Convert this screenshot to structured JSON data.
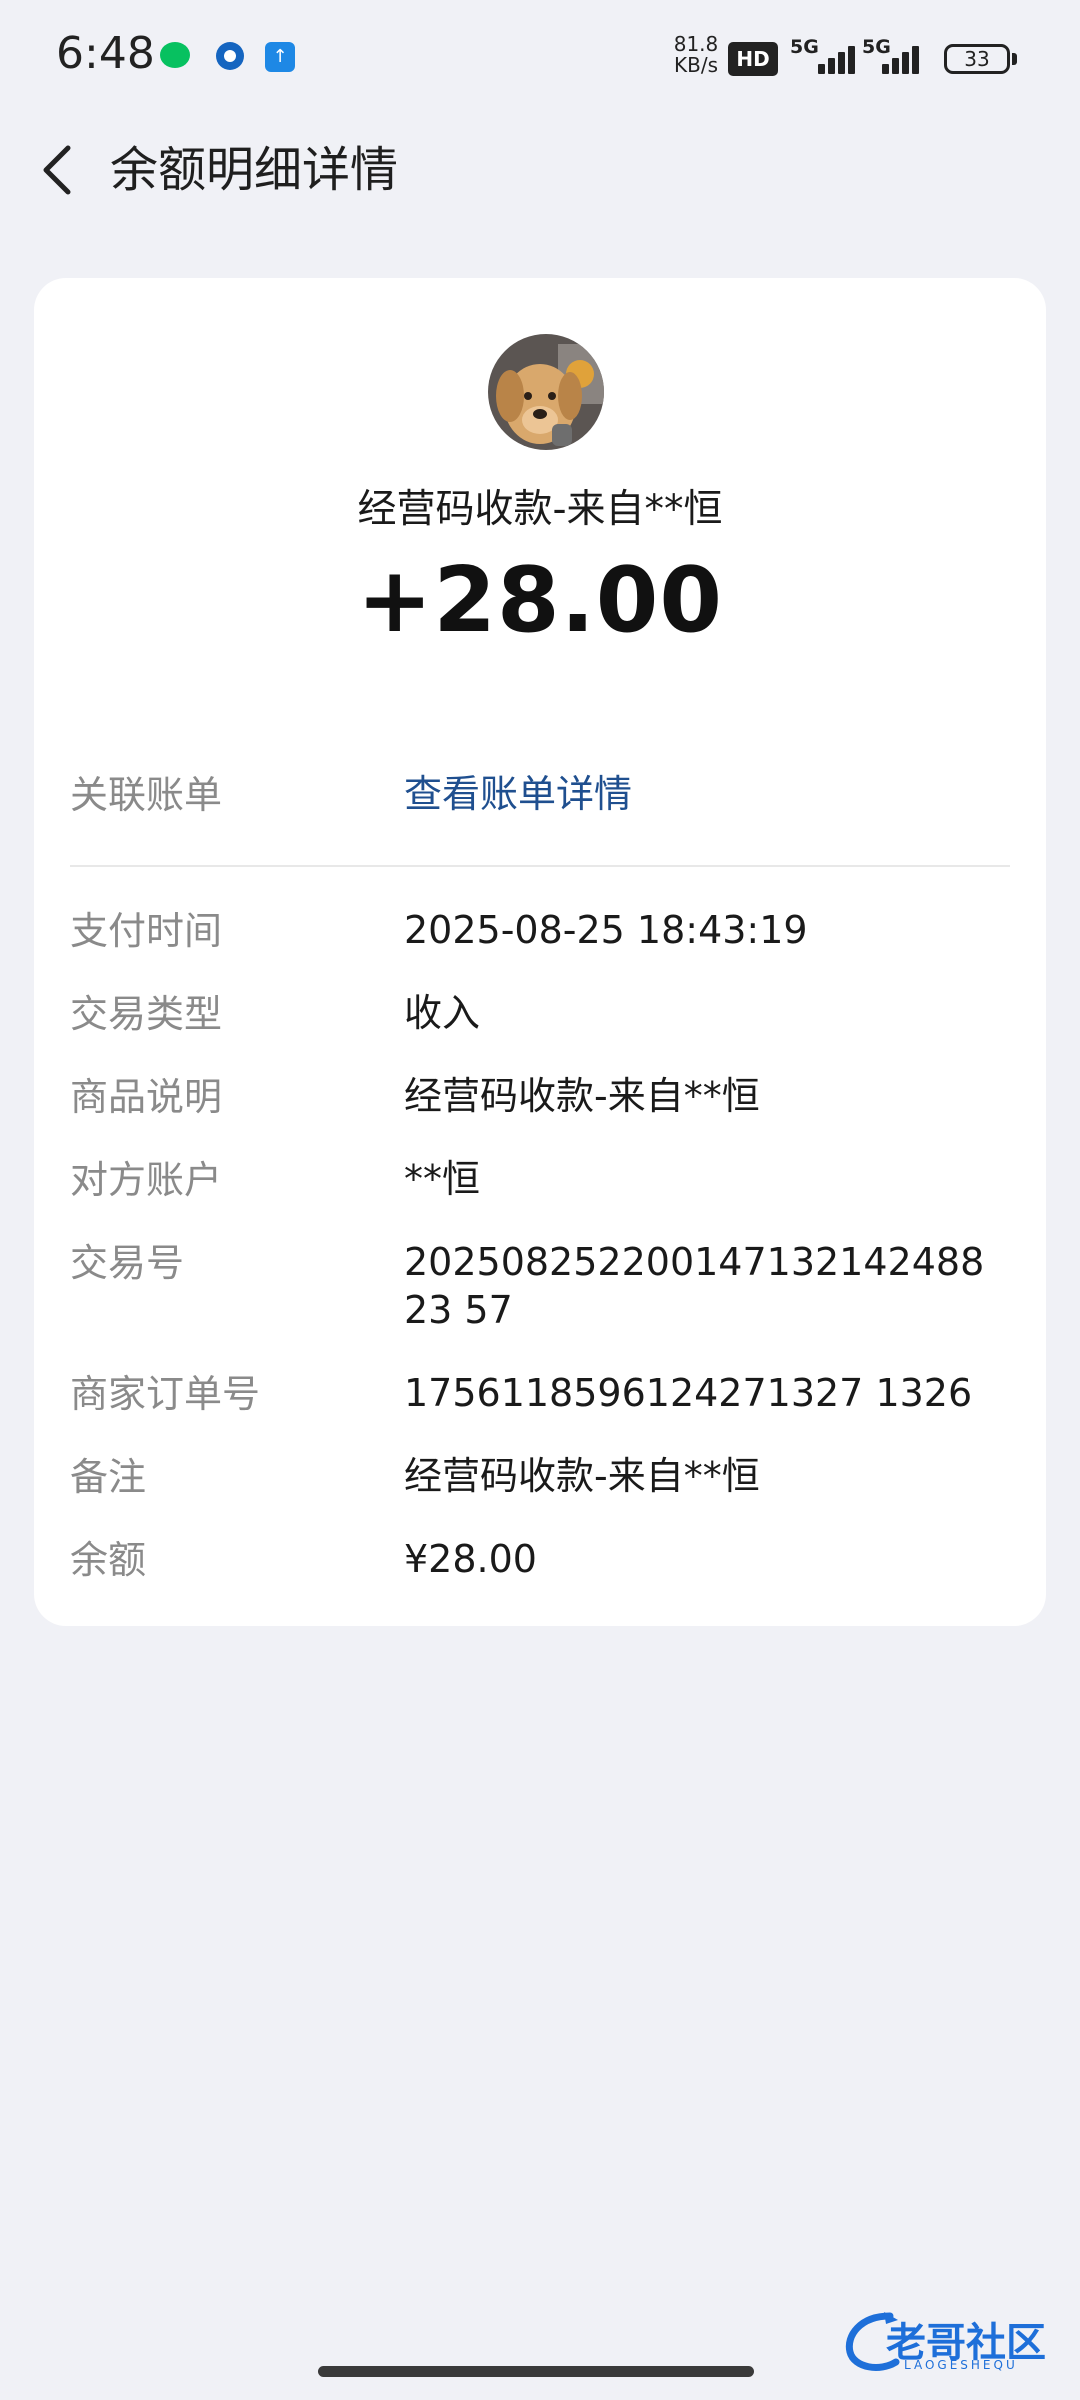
{
  "status_bar": {
    "time": "6:48",
    "net_speed_value": "81.8",
    "net_speed_unit": "KB/s",
    "hd_label": "HD",
    "sim1_type": "5G",
    "sim2_type": "5G",
    "battery": "33"
  },
  "header": {
    "title": "余额明细详情"
  },
  "transaction": {
    "subtitle": "经营码收款-来自**恒",
    "amount": "+28.00"
  },
  "related_bill": {
    "label": "关联账单",
    "link_text": "查看账单详情"
  },
  "details": [
    {
      "label": "支付时间",
      "value": "2025-08-25 18:43:19"
    },
    {
      "label": "交易类型",
      "value": "收入"
    },
    {
      "label": "商品说明",
      "value": "经营码收款-来自**恒"
    },
    {
      "label": "对方账户",
      "value": "**恒"
    },
    {
      "label": "交易号",
      "value": "20250825220014713214248823 57"
    },
    {
      "label": "商家订单号",
      "value": "1756118596124271327 1326"
    },
    {
      "label": "备注",
      "value": "经营码收款-来自**恒"
    },
    {
      "label": "余额",
      "value": "¥28.00"
    }
  ],
  "watermark": {
    "text": "老哥社区",
    "sub": "LAOGESHEQU"
  },
  "colors": {
    "background": "#f0f1f6",
    "card": "#ffffff",
    "link": "#1f4f8f",
    "label_gray": "#8a8a8a"
  }
}
